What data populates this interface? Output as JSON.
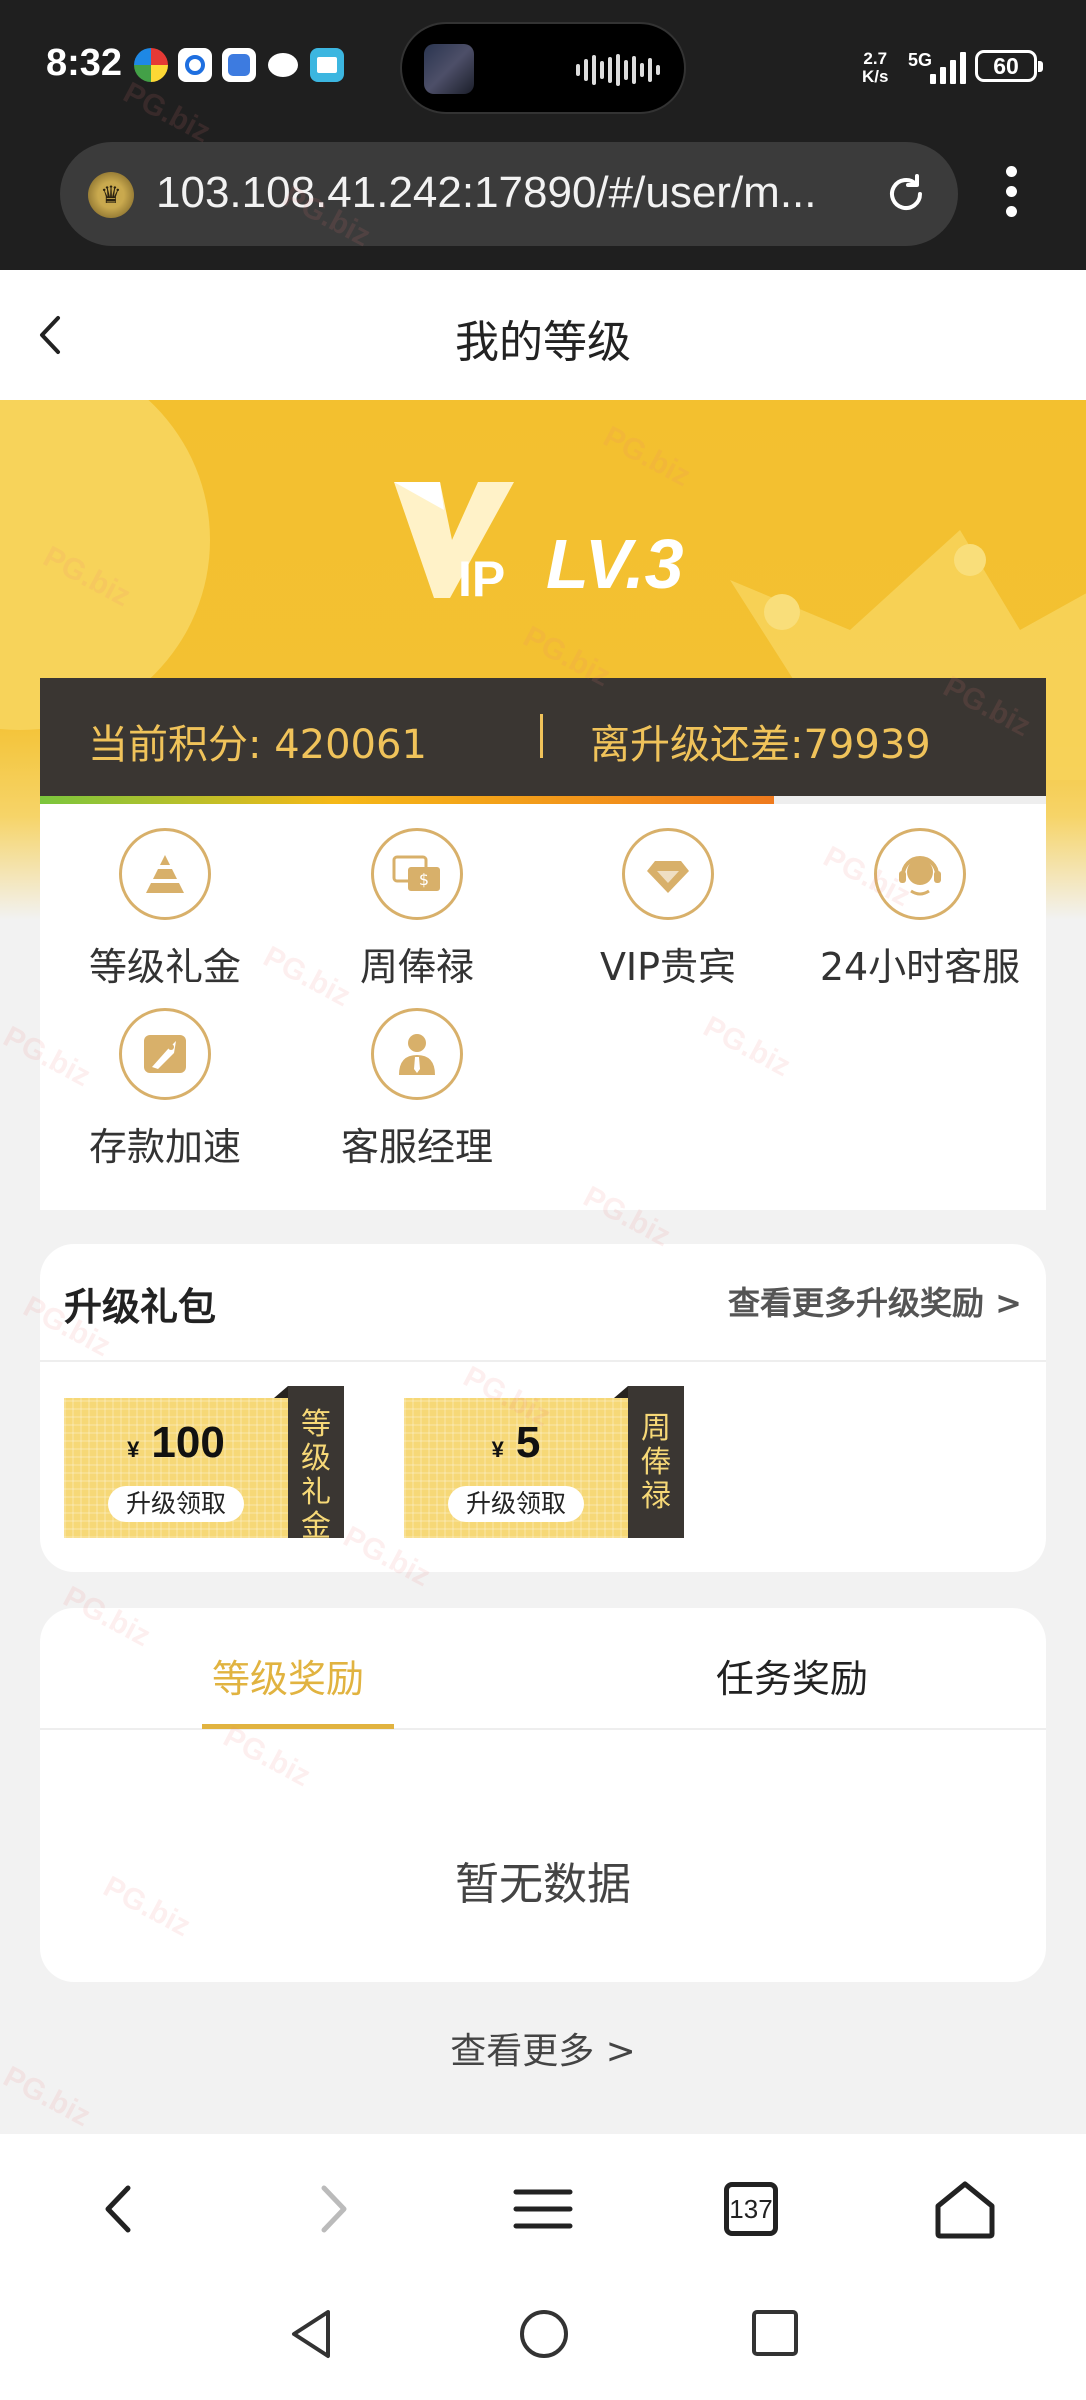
{
  "status_bar": {
    "time": "8:32",
    "net_speed_value": "2.7",
    "net_speed_unit": "K/s",
    "network": "5G",
    "battery": "60"
  },
  "browser": {
    "url": "103.108.41.242:17890/#/user/m...",
    "tab_count": "137"
  },
  "header": {
    "title": "我的等级"
  },
  "banner": {
    "vip_label": "IP",
    "level": "LV.3"
  },
  "score": {
    "current_label": "当前积分:",
    "current_value": "420061",
    "remaining_label": "离升级还差:",
    "remaining_value": "79939",
    "progress_fraction": 0.73
  },
  "privileges": [
    {
      "label": "等级礼金",
      "icon": "pyramid-icon"
    },
    {
      "label": "周俸禄",
      "icon": "salary-card-icon"
    },
    {
      "label": "VIP贵宾",
      "icon": "diamond-icon"
    },
    {
      "label": "24小时客服",
      "icon": "headset-icon"
    },
    {
      "label": "存款加速",
      "icon": "rocket-icon"
    },
    {
      "label": "客服经理",
      "icon": "manager-icon"
    }
  ],
  "upgrade_gift": {
    "title": "升级礼包",
    "more": "查看更多升级奖励 >",
    "coupons": [
      {
        "currency": "¥",
        "amount": "100",
        "button": "升级领取",
        "tag": "等级礼金"
      },
      {
        "currency": "¥",
        "amount": "5",
        "button": "升级领取",
        "tag": "周俸禄"
      }
    ]
  },
  "rewards": {
    "tabs": [
      "等级奖励",
      "任务奖励"
    ],
    "active_tab": 0,
    "empty": "暂无数据"
  },
  "see_more": "查看更多 >",
  "watermark": "PG.biz",
  "colors": {
    "gold": "#f3c02f",
    "accent": "#e1b340",
    "dark": "#3a3632"
  }
}
